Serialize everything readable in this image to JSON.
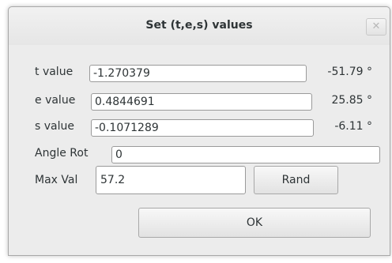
{
  "dialog": {
    "title": "Set (t,e,s) values",
    "close_glyph": "✕"
  },
  "rows": {
    "t": {
      "label": "t value",
      "value": "-1.270379",
      "degrees": "-51.79 °"
    },
    "e": {
      "label": "e value",
      "value": "0.4844691",
      "degrees": "25.85 °"
    },
    "s": {
      "label": "s value",
      "value": "-0.1071289",
      "degrees": "-6.11 °"
    },
    "angle": {
      "label": "Angle Rot",
      "value": "0"
    },
    "max": {
      "label": "Max Val",
      "value": "57.2"
    }
  },
  "buttons": {
    "rand_label": "Rand",
    "ok_label": "OK"
  }
}
